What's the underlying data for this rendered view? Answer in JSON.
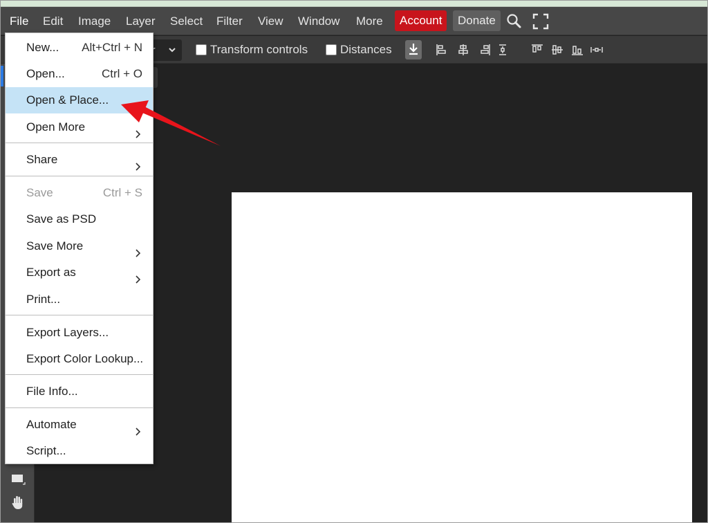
{
  "menubar": {
    "items": [
      "File",
      "Edit",
      "Image",
      "Layer",
      "Select",
      "Filter",
      "View",
      "Window",
      "More"
    ],
    "account_label": "Account",
    "donate_label": "Donate",
    "search_icon": "search-icon",
    "fullscreen_icon": "fullscreen-icon",
    "account_color": "#c8141c"
  },
  "options": {
    "select_partial": "r",
    "transform_controls_label": "Transform controls",
    "distances_label": "Distances",
    "icons": [
      "download-icon",
      "align-left-icon",
      "align-center-h-icon",
      "align-right-icon",
      "distribute-h-icon",
      "align-top-icon",
      "align-middle-v-icon",
      "align-bottom-icon",
      "distribute-v-icon"
    ]
  },
  "file_menu": {
    "items": [
      {
        "label": "New...",
        "shortcut": "Alt+Ctrl + N"
      },
      {
        "label": "Open...",
        "shortcut": "Ctrl + O"
      },
      {
        "label": "Open & Place...",
        "shortcut": "",
        "highlighted": true
      },
      {
        "label": "Open More",
        "submenu": true
      },
      {
        "label": "Share",
        "submenu": true
      },
      {
        "label": "Save",
        "shortcut": "Ctrl + S",
        "disabled": true
      },
      {
        "label": "Save as PSD",
        "shortcut": ""
      },
      {
        "label": "Save More",
        "submenu": true
      },
      {
        "label": "Export as",
        "submenu": true
      },
      {
        "label": "Print...",
        "shortcut": ""
      },
      {
        "label": "Export Layers...",
        "shortcut": ""
      },
      {
        "label": "Export Color Lookup...",
        "shortcut": ""
      },
      {
        "label": "File Info...",
        "shortcut": ""
      },
      {
        "label": "Automate",
        "submenu": true
      },
      {
        "label": "Script...",
        "shortcut": ""
      }
    ],
    "highlight_color": "#c5e3f6"
  },
  "annotation": {
    "arrow_color": "#e8141b"
  },
  "tools": [
    "rectangle-tool-icon",
    "hand-tool-icon"
  ]
}
